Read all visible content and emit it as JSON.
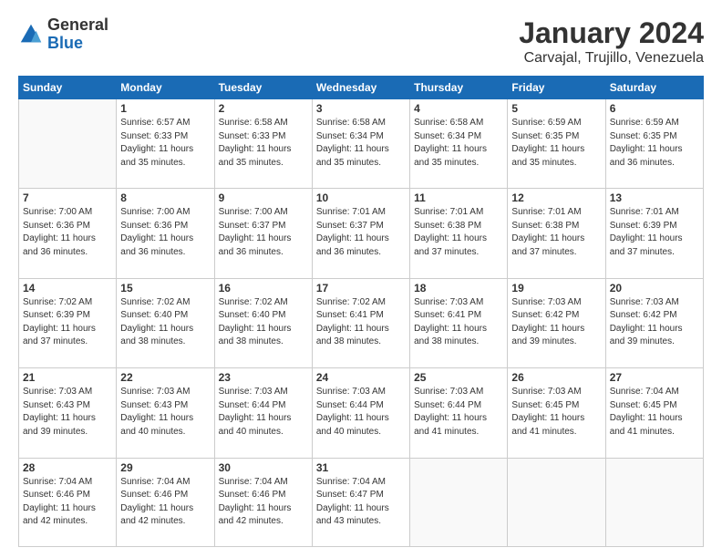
{
  "header": {
    "logo": {
      "general": "General",
      "blue": "Blue"
    },
    "title": "January 2024",
    "subtitle": "Carvajal, Trujillo, Venezuela"
  },
  "calendar": {
    "weekdays": [
      "Sunday",
      "Monday",
      "Tuesday",
      "Wednesday",
      "Thursday",
      "Friday",
      "Saturday"
    ],
    "weeks": [
      [
        {
          "day": "",
          "info": ""
        },
        {
          "day": "1",
          "info": "Sunrise: 6:57 AM\nSunset: 6:33 PM\nDaylight: 11 hours\nand 35 minutes."
        },
        {
          "day": "2",
          "info": "Sunrise: 6:58 AM\nSunset: 6:33 PM\nDaylight: 11 hours\nand 35 minutes."
        },
        {
          "day": "3",
          "info": "Sunrise: 6:58 AM\nSunset: 6:34 PM\nDaylight: 11 hours\nand 35 minutes."
        },
        {
          "day": "4",
          "info": "Sunrise: 6:58 AM\nSunset: 6:34 PM\nDaylight: 11 hours\nand 35 minutes."
        },
        {
          "day": "5",
          "info": "Sunrise: 6:59 AM\nSunset: 6:35 PM\nDaylight: 11 hours\nand 35 minutes."
        },
        {
          "day": "6",
          "info": "Sunrise: 6:59 AM\nSunset: 6:35 PM\nDaylight: 11 hours\nand 36 minutes."
        }
      ],
      [
        {
          "day": "7",
          "info": "Sunrise: 7:00 AM\nSunset: 6:36 PM\nDaylight: 11 hours\nand 36 minutes."
        },
        {
          "day": "8",
          "info": "Sunrise: 7:00 AM\nSunset: 6:36 PM\nDaylight: 11 hours\nand 36 minutes."
        },
        {
          "day": "9",
          "info": "Sunrise: 7:00 AM\nSunset: 6:37 PM\nDaylight: 11 hours\nand 36 minutes."
        },
        {
          "day": "10",
          "info": "Sunrise: 7:01 AM\nSunset: 6:37 PM\nDaylight: 11 hours\nand 36 minutes."
        },
        {
          "day": "11",
          "info": "Sunrise: 7:01 AM\nSunset: 6:38 PM\nDaylight: 11 hours\nand 37 minutes."
        },
        {
          "day": "12",
          "info": "Sunrise: 7:01 AM\nSunset: 6:38 PM\nDaylight: 11 hours\nand 37 minutes."
        },
        {
          "day": "13",
          "info": "Sunrise: 7:01 AM\nSunset: 6:39 PM\nDaylight: 11 hours\nand 37 minutes."
        }
      ],
      [
        {
          "day": "14",
          "info": "Sunrise: 7:02 AM\nSunset: 6:39 PM\nDaylight: 11 hours\nand 37 minutes."
        },
        {
          "day": "15",
          "info": "Sunrise: 7:02 AM\nSunset: 6:40 PM\nDaylight: 11 hours\nand 38 minutes."
        },
        {
          "day": "16",
          "info": "Sunrise: 7:02 AM\nSunset: 6:40 PM\nDaylight: 11 hours\nand 38 minutes."
        },
        {
          "day": "17",
          "info": "Sunrise: 7:02 AM\nSunset: 6:41 PM\nDaylight: 11 hours\nand 38 minutes."
        },
        {
          "day": "18",
          "info": "Sunrise: 7:03 AM\nSunset: 6:41 PM\nDaylight: 11 hours\nand 38 minutes."
        },
        {
          "day": "19",
          "info": "Sunrise: 7:03 AM\nSunset: 6:42 PM\nDaylight: 11 hours\nand 39 minutes."
        },
        {
          "day": "20",
          "info": "Sunrise: 7:03 AM\nSunset: 6:42 PM\nDaylight: 11 hours\nand 39 minutes."
        }
      ],
      [
        {
          "day": "21",
          "info": "Sunrise: 7:03 AM\nSunset: 6:43 PM\nDaylight: 11 hours\nand 39 minutes."
        },
        {
          "day": "22",
          "info": "Sunrise: 7:03 AM\nSunset: 6:43 PM\nDaylight: 11 hours\nand 40 minutes."
        },
        {
          "day": "23",
          "info": "Sunrise: 7:03 AM\nSunset: 6:44 PM\nDaylight: 11 hours\nand 40 minutes."
        },
        {
          "day": "24",
          "info": "Sunrise: 7:03 AM\nSunset: 6:44 PM\nDaylight: 11 hours\nand 40 minutes."
        },
        {
          "day": "25",
          "info": "Sunrise: 7:03 AM\nSunset: 6:44 PM\nDaylight: 11 hours\nand 41 minutes."
        },
        {
          "day": "26",
          "info": "Sunrise: 7:03 AM\nSunset: 6:45 PM\nDaylight: 11 hours\nand 41 minutes."
        },
        {
          "day": "27",
          "info": "Sunrise: 7:04 AM\nSunset: 6:45 PM\nDaylight: 11 hours\nand 41 minutes."
        }
      ],
      [
        {
          "day": "28",
          "info": "Sunrise: 7:04 AM\nSunset: 6:46 PM\nDaylight: 11 hours\nand 42 minutes."
        },
        {
          "day": "29",
          "info": "Sunrise: 7:04 AM\nSunset: 6:46 PM\nDaylight: 11 hours\nand 42 minutes."
        },
        {
          "day": "30",
          "info": "Sunrise: 7:04 AM\nSunset: 6:46 PM\nDaylight: 11 hours\nand 42 minutes."
        },
        {
          "day": "31",
          "info": "Sunrise: 7:04 AM\nSunset: 6:47 PM\nDaylight: 11 hours\nand 43 minutes."
        },
        {
          "day": "",
          "info": ""
        },
        {
          "day": "",
          "info": ""
        },
        {
          "day": "",
          "info": ""
        }
      ]
    ]
  }
}
